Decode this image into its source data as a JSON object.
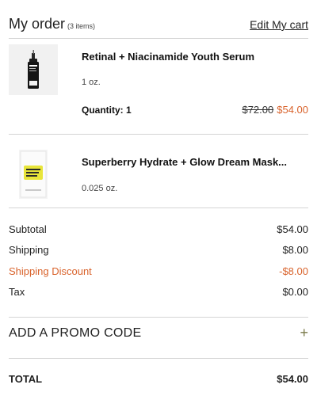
{
  "header": {
    "title": "My order",
    "count": "(3 items)",
    "edit_link": "Edit My cart"
  },
  "items": [
    {
      "name": "Retinal + Niacinamide Youth Serum",
      "size": "1 oz.",
      "quantity": "Quantity: 1",
      "old_price": "$72.00",
      "price": "$54.00",
      "image_icon": "serum-bottle-icon"
    },
    {
      "name": "Superberry Hydrate + Glow Dream Mask...",
      "size": "0.025 oz.",
      "image_icon": "mask-sachet-icon"
    }
  ],
  "summary": {
    "subtotal_label": "Subtotal",
    "subtotal": "$54.00",
    "shipping_label": "Shipping",
    "shipping": "$8.00",
    "discount_label": "Shipping Discount",
    "discount": "-$8.00",
    "tax_label": "Tax",
    "tax": "$0.00"
  },
  "promo": {
    "label": "ADD A PROMO CODE",
    "icon": "plus-icon"
  },
  "total": {
    "label": "TOTAL",
    "value": "$54.00"
  },
  "colors": {
    "accent": "#d9632c",
    "divider": "#d4d4d4",
    "text": "#222222"
  }
}
